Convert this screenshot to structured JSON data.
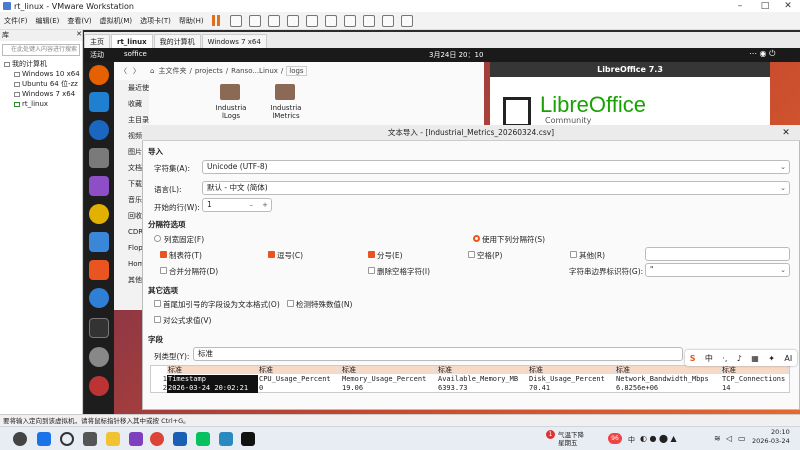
{
  "vmware": {
    "title": "rt_linux - VMware Workstation",
    "menu": [
      "文件(F)",
      "编辑(E)",
      "查看(V)",
      "虚拟机(M)",
      "选项卡(T)",
      "帮助(H)"
    ],
    "library": {
      "title": "库",
      "search_placeholder": "在此处键入内容进行搜索",
      "root": "我的计算机",
      "vms": [
        "Windows 10 x64",
        "Ubuntu 64 位-zz",
        "Windows 7 x64",
        "rt_linux"
      ]
    },
    "tabs": [
      "主页",
      "rt_linux",
      "我的计算机",
      "Windows 7 x64"
    ],
    "status": "要将输入定向到该虚拟机，请将鼠标指针移入其中或按 Ctrl+G。"
  },
  "ubuntu": {
    "activities": "活动",
    "app": "soffice",
    "datetime": "3月24日  20：10"
  },
  "files": {
    "path": [
      "主文件夹",
      "projects",
      "Ranso...Linux",
      "logs"
    ],
    "sidebar": [
      "最近使用",
      "收藏",
      "主目录",
      "视频",
      "图片",
      "文档",
      "下载",
      "音乐",
      "回收站",
      "CDROM",
      "Floppy",
      "Home",
      "其他位置"
    ],
    "folders": [
      "Industria lLogs",
      "Industria lMetrics"
    ]
  },
  "libreoffice": {
    "header": "LibreOffice 7.3",
    "logo": "LibreOffice",
    "sub": "Community"
  },
  "dialog": {
    "title": "文本导入 - [Industrial_Metrics_20260324.csv]",
    "import": "导入",
    "charset_label": "字符集(A):",
    "charset": "Unicode (UTF-8)",
    "lang_label": "语言(L):",
    "lang": "默认 - 中文 (简体)",
    "from_row_label": "开始的行(W):",
    "from_row": "1",
    "sep_header": "分隔符选项",
    "fixed": "列宽固定(F)",
    "separated": "使用下列分隔符(S)",
    "tab": "制表符(T)",
    "comma": "逗号(C)",
    "semicolon": "分号(E)",
    "space": "空格(P)",
    "other": "其他(R)",
    "merge": "合并分隔符(D)",
    "trim": "删除空格字符(I)",
    "string_delim_label": "字符串边界标识符(G):",
    "string_delim": "\"",
    "other_header": "其它选项",
    "quoted_text": "首尾加引号的字段设为文本格式(O)",
    "detect": "检测特殊数值(N)",
    "formulas": "对公式求值(V)",
    "fields_header": "字段",
    "coltype_label": "列类型(Y):",
    "coltype": "标准",
    "col_type_row": [
      "标准",
      "标准",
      "标准",
      "标准",
      "标准",
      "标准",
      "标准"
    ],
    "rows": [
      [
        "Timestamp",
        "CPU_Usage_Percent",
        "Memory_Usage_Percent",
        "Available_Memory_MB",
        "Disk_Usage_Percent",
        "Network_Bandwidth_Mbps",
        "TCP_Connections"
      ],
      [
        "2026-03-24 20:02:21",
        "0",
        "19.06",
        "6393.73",
        "70.41",
        "6.8256e+06",
        "14"
      ]
    ]
  },
  "ime": [
    "中",
    "·,",
    "AI"
  ],
  "taskbar": {
    "weather": "气温下降",
    "weather_sub": "星期五",
    "badge": "1",
    "tray_num": "96",
    "time": "20:10",
    "date": "2026-03-24",
    "lang": "中"
  }
}
